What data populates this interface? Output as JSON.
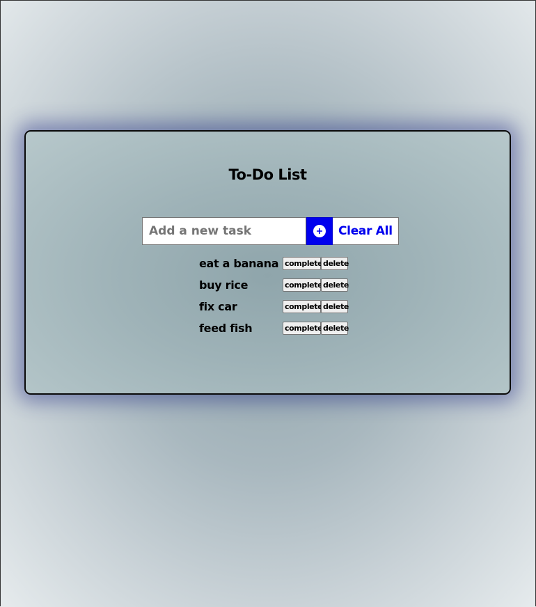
{
  "app": {
    "title": "To-Do List"
  },
  "input": {
    "placeholder": "Add a new task",
    "value": ""
  },
  "add_button": {
    "icon": "plus-circle-icon",
    "color": "#0000ee"
  },
  "clear_button": {
    "label": "Clear All",
    "color": "#0000ee"
  },
  "tasks": [
    {
      "text": "eat a banana",
      "complete_label": "complete",
      "delete_label": "delete"
    },
    {
      "text": "buy rice",
      "complete_label": "complete",
      "delete_label": "delete"
    },
    {
      "text": "fix car",
      "complete_label": "complete",
      "delete_label": "delete"
    },
    {
      "text": "feed fish",
      "complete_label": "complete",
      "delete_label": "delete"
    }
  ]
}
